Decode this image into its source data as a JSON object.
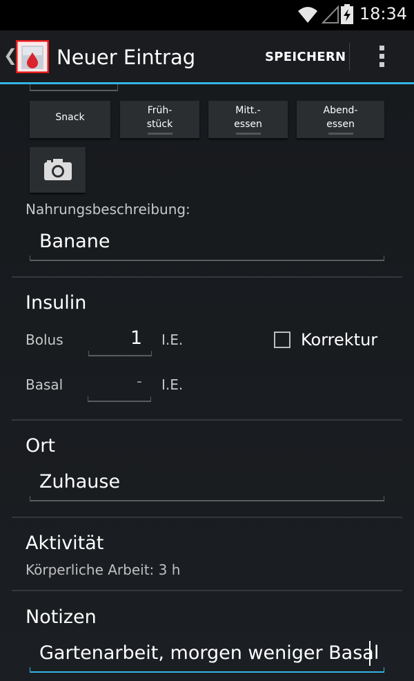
{
  "status_bar": {
    "time": "18:34"
  },
  "action_bar": {
    "title": "Neuer Eintrag",
    "save_label": "SPEICHERN"
  },
  "meal_buttons": [
    {
      "label": "Snack"
    },
    {
      "label": "Früh-\nstück"
    },
    {
      "label": "Mitt.-\nessen"
    },
    {
      "label": "Abend-\nessen"
    }
  ],
  "food": {
    "label": "Nahrungsbeschreibung:",
    "value": "Banane"
  },
  "insulin": {
    "title": "Insulin",
    "bolus_label": "Bolus",
    "bolus_value": "1",
    "bolus_unit": "I.E.",
    "basal_label": "Basal",
    "basal_value": "-",
    "basal_unit": "I.E.",
    "correction_label": "Korrektur",
    "correction_checked": false
  },
  "location": {
    "title": "Ort",
    "value": "Zuhause"
  },
  "activity": {
    "title": "Aktivität",
    "summary": "Körperliche Arbeit: 3 h"
  },
  "notes": {
    "title": "Notizen",
    "value": "Gartenarbeit, morgen weniger Basal"
  },
  "colors": {
    "accent": "#33b5e5",
    "background": "#101214",
    "button": "#2b2e31"
  }
}
